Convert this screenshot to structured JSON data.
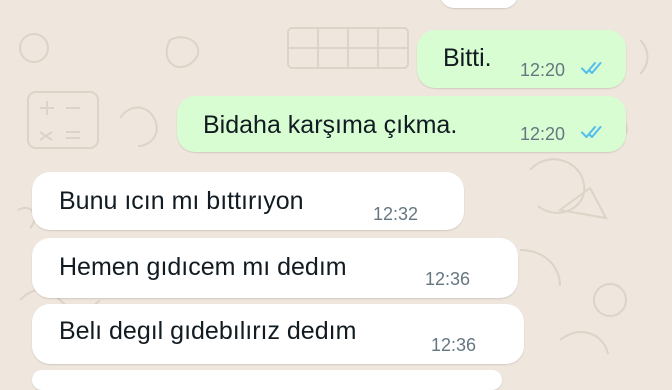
{
  "colors": {
    "outgoing_bubble": "#d9fdd3",
    "incoming_bubble": "#ffffff",
    "wallpaper": "#efe7dd",
    "read_ticks": "#53bdeb",
    "timestamp": "#667781"
  },
  "messages": [
    {
      "direction": "outgoing",
      "text": "Bitti.",
      "time": "12:20",
      "status_icon": "double-check-read-icon"
    },
    {
      "direction": "outgoing",
      "text": "Bidaha karşıma çıkma.",
      "time": "12:20",
      "status_icon": "double-check-read-icon"
    },
    {
      "direction": "incoming",
      "text": "Bunu ıcın mı bıttırıyon",
      "time": "12:32"
    },
    {
      "direction": "incoming",
      "text": "Hemen gıdıcem mı dedım",
      "time": "12:36"
    },
    {
      "direction": "incoming",
      "text": "Belı degıl gıdebılırız dedım",
      "time": "12:36"
    }
  ]
}
